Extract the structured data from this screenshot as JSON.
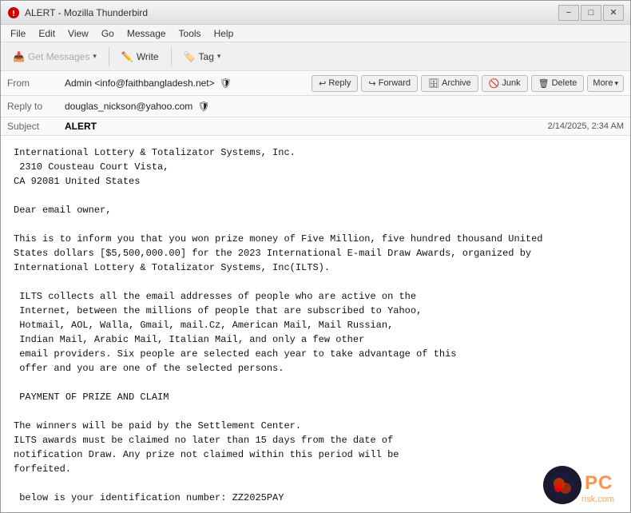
{
  "window": {
    "title": "ALERT - Mozilla Thunderbird",
    "icon": "🦅"
  },
  "titlebar": {
    "title_text": "ALERT - Mozilla Thunderbird",
    "minimize_label": "−",
    "maximize_label": "□",
    "close_label": "✕"
  },
  "menubar": {
    "items": [
      {
        "label": "File",
        "id": "menu-file"
      },
      {
        "label": "Edit",
        "id": "menu-edit"
      },
      {
        "label": "View",
        "id": "menu-view"
      },
      {
        "label": "Go",
        "id": "menu-go"
      },
      {
        "label": "Message",
        "id": "menu-message"
      },
      {
        "label": "Tools",
        "id": "menu-tools"
      },
      {
        "label": "Help",
        "id": "menu-help"
      }
    ]
  },
  "toolbar": {
    "get_messages_label": "Get Messages",
    "write_label": "Write",
    "tag_label": "Tag",
    "get_messages_disabled": true
  },
  "header": {
    "from_label": "From",
    "from_value": "Admin <info@faithbangladesh.net>",
    "reply_to_label": "Reply to",
    "reply_to_value": "douglas_nickson@yahoo.com",
    "subject_label": "Subject",
    "subject_value": "ALERT",
    "date_value": "2/14/2025, 2:34 AM",
    "buttons": {
      "reply": "Reply",
      "forward": "Forward",
      "archive": "Archive",
      "junk": "Junk",
      "delete": "Delete",
      "more": "More"
    }
  },
  "body": {
    "text": "International Lottery & Totalizator Systems, Inc.\n 2310 Cousteau Court Vista,\nCA 92081 United States\n\nDear email owner,\n\nThis is to inform you that you won prize money of Five Million, five hundred thousand United\nStates dollars [$5,500,000.00] for the 2023 International E-mail Draw Awards, organized by\nInternational Lottery & Totalizator Systems, Inc(ILTS).\n\n ILTS collects all the email addresses of people who are active on the\n Internet, between the millions of people that are subscribed to Yahoo,\n Hotmail, AOL, Walla, Gmail, mail.Cz, American Mail, Mail Russian,\n Indian Mail, Arabic Mail, Italian Mail, and only a few other\n email providers. Six people are selected each year to take advantage of this\n offer and you are one of the selected persons.\n\n PAYMENT OF PRIZE AND CLAIM\n\nThe winners will be paid by the Settlement Center.\nILTS awards must be claimed no later than 15 days from the date of\nnotification Draw. Any prize not claimed within this period will be\nforfeited.\n\n below is your identification number: ZZ2025PAY"
  },
  "watermark": {
    "site": "pcrisk.com"
  }
}
